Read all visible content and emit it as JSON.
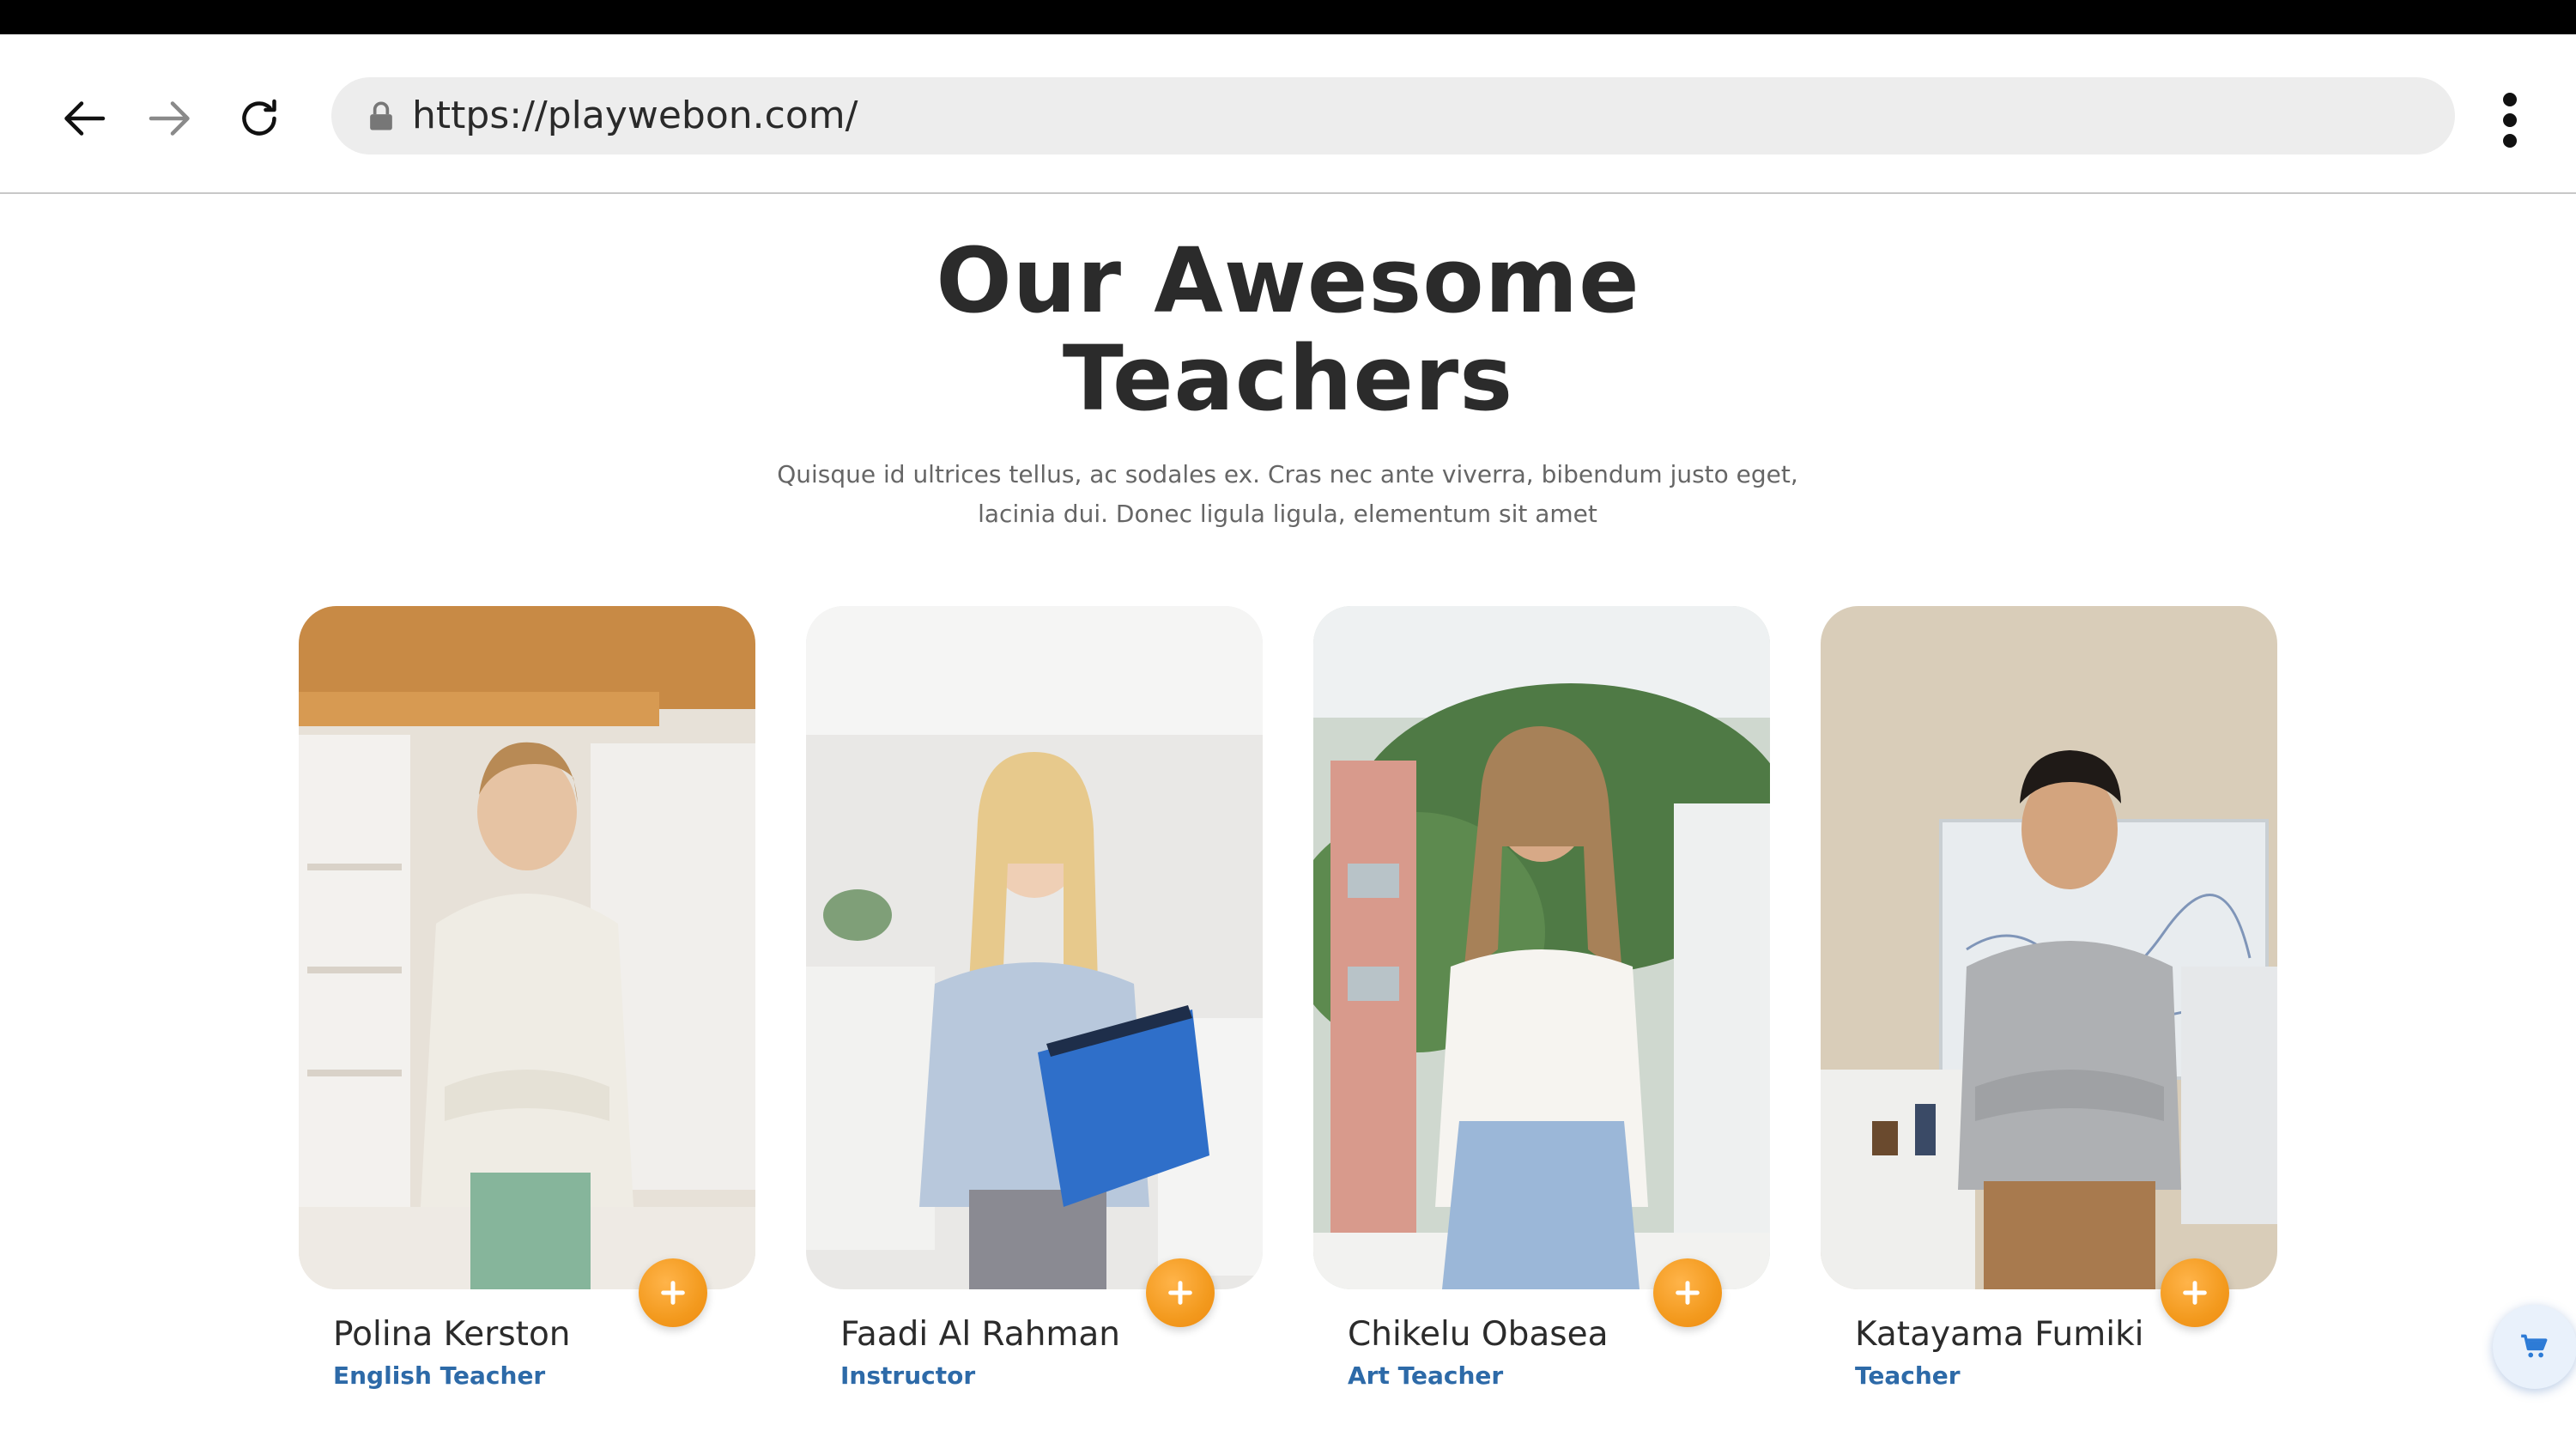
{
  "browser": {
    "url": "https://playwebon.com/",
    "icons": {
      "back": "arrow-left-icon",
      "forward": "arrow-right-icon",
      "reload": "reload-icon",
      "lock": "lock-icon",
      "menu": "more-vertical-icon"
    }
  },
  "section": {
    "title_line1": "Our Awesome",
    "title_line2": "Teachers",
    "description_line1": "Quisque id ultrices tellus, ac sodales ex. Cras nec ante viverra, bibendum justo eget,",
    "description_line2": "lacinia dui. Donec ligula ligula, elementum sit amet"
  },
  "teachers": [
    {
      "name": "Polina Kerston",
      "role": "English Teacher"
    },
    {
      "name": "Faadi Al Rahman",
      "role": "Instructor"
    },
    {
      "name": "Chikelu Obasea",
      "role": "Art Teacher"
    },
    {
      "name": "Katayama Fumiki",
      "role": "Teacher"
    }
  ],
  "colors": {
    "accent_orange": "#f39a1e",
    "role_blue": "#2d6aa8",
    "heading": "#2b2b2b"
  },
  "floating": {
    "cart_icon": "shopping-cart-icon"
  }
}
